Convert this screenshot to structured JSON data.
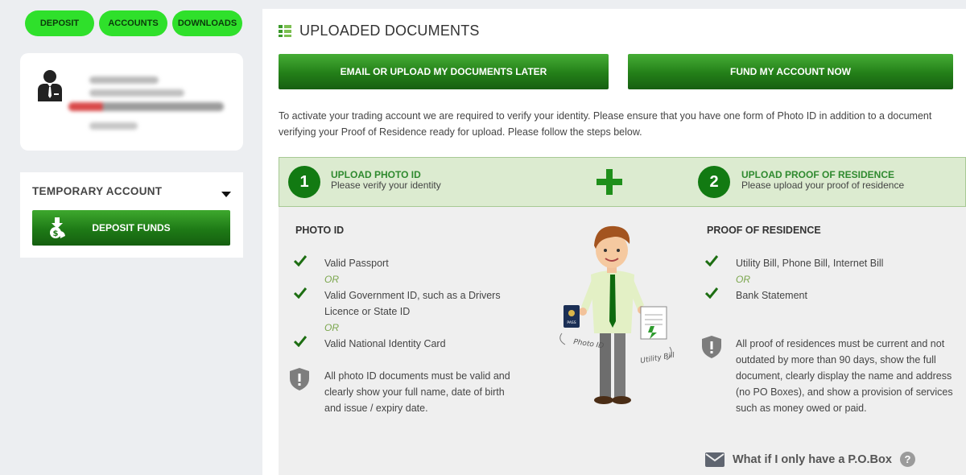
{
  "nav": {
    "deposit": "DEPOSIT",
    "accounts": "ACCOUNTS",
    "downloads": "DOWNLOADS",
    "color": "#2fe02b"
  },
  "sidebar": {
    "account_title": "TEMPORARY ACCOUNT",
    "deposit_button": "DEPOSIT FUNDS"
  },
  "main": {
    "title": "UPLOADED DOCUMENTS",
    "btn_later": "EMAIL OR UPLOAD MY DOCUMENTS LATER",
    "btn_fund": "FUND MY ACCOUNT NOW",
    "intro": "To activate your trading account we are required to verify your identity. Please ensure that you have one form of Photo ID in addition to a document verifying your Proof of Residence ready for upload. Please follow the steps below.",
    "step1": {
      "num": "1",
      "title": "UPLOAD PHOTO ID",
      "sub": "Please verify your identity"
    },
    "step2": {
      "num": "2",
      "title": "UPLOAD PROOF OF RESIDENCE",
      "sub": "Please upload your proof of residence"
    },
    "photo": {
      "heading": "PHOTO ID",
      "items": [
        "Valid Passport",
        "Valid Government ID, such as a Drivers Licence or State ID",
        "Valid National Identity Card"
      ],
      "or": "OR",
      "note": "All photo ID documents must be valid and clearly show your full name, date of birth and issue / expiry date."
    },
    "illustration": {
      "label_photo": "Photo ID",
      "label_bill": "Utility Bill",
      "pass": "PASS"
    },
    "residence": {
      "heading": "PROOF OF RESIDENCE",
      "items": [
        "Utility Bill, Phone Bill, Internet Bill",
        "Bank Statement"
      ],
      "or": "OR",
      "note": "All proof of residences must be current and not outdated by more than 90 days, show the full document, clearly display the name and address (no PO Boxes), and show a provision of services such as money owed or paid."
    },
    "pobox": "What if I only have a P.O.Box",
    "pobox_help": "?"
  },
  "colors": {
    "green_dark": "#127a12",
    "step_bg": "#dcebd0",
    "or_green": "#7aa64c"
  }
}
